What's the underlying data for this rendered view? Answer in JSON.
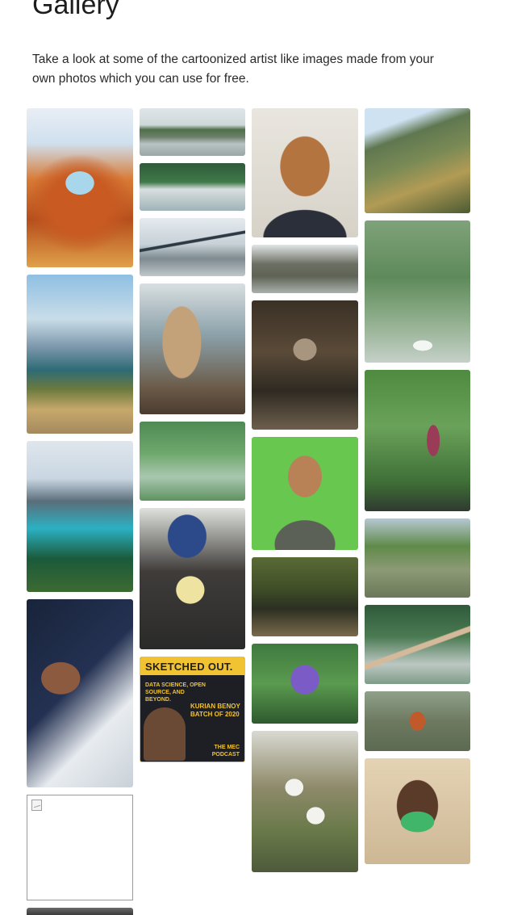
{
  "page": {
    "title": "Gallery",
    "intro": "Take a look at some of the cartoonized artist like images made from your own photos which you can use for free."
  },
  "gallery": {
    "podcast": {
      "title": "SKETCHED OUT.",
      "tagline": "DATA SCIENCE, OPEN SOURCE, AND BEYOND.",
      "guest": "KURIAN BENOY",
      "guest_note": "BATCH OF 2020",
      "footer": "THE MEC PODCAST"
    },
    "tiles": [
      {
        "id": "arch",
        "subject": "red rock arch"
      },
      {
        "id": "flood1",
        "subject": "flooded street"
      },
      {
        "id": "face1",
        "subject": "smiling man portrait"
      },
      {
        "id": "hills",
        "subject": "green hills"
      },
      {
        "id": "flood2",
        "subject": "flooded road with trees"
      },
      {
        "id": "bridge",
        "subject": "suspension bridge"
      },
      {
        "id": "building",
        "subject": "building facade"
      },
      {
        "id": "fountain",
        "subject": "water fountain"
      },
      {
        "id": "lake1",
        "subject": "mountain lake"
      },
      {
        "id": "camel",
        "subject": "camel"
      },
      {
        "id": "owl",
        "subject": "owl in branches"
      },
      {
        "id": "plants",
        "subject": "potted plants"
      },
      {
        "id": "path",
        "subject": "forest path"
      },
      {
        "id": "man-green",
        "subject": "man holding frame"
      },
      {
        "id": "palms",
        "subject": "palm trees"
      },
      {
        "id": "lake2",
        "subject": "turquoise lake"
      },
      {
        "id": "man-cert",
        "subject": "man holding certificate"
      },
      {
        "id": "river",
        "subject": "forest river"
      },
      {
        "id": "road",
        "subject": "park road"
      },
      {
        "id": "snowman",
        "subject": "selfie on snowy mountain"
      },
      {
        "id": "podcast",
        "subject": "podcast poster"
      },
      {
        "id": "lotus",
        "subject": "purple water lily"
      },
      {
        "id": "paraglide",
        "subject": "paragliding"
      },
      {
        "id": "orchid",
        "subject": "white orchids"
      },
      {
        "id": "mask",
        "subject": "person in mask"
      },
      {
        "id": "broken",
        "subject": "broken image"
      },
      {
        "id": "partial",
        "subject": "partially visible image"
      }
    ]
  }
}
